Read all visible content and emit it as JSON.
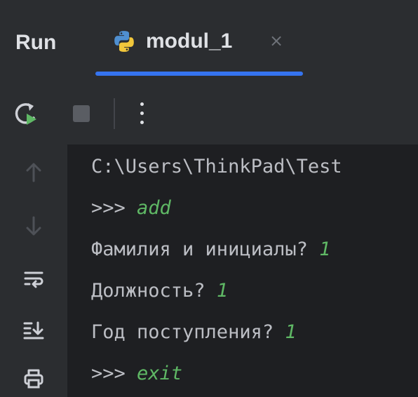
{
  "header": {
    "tool_window_title": "Run",
    "tab": {
      "title": "modul_1",
      "close_glyph": "×",
      "icon": "python-icon"
    }
  },
  "toolbar": {
    "icons": [
      "rerun-icon",
      "stop-icon",
      "more-options-icon"
    ]
  },
  "gutter": {
    "icons": [
      "scroll-up-icon",
      "scroll-down-icon",
      "soft-wrap-icon",
      "scroll-to-end-icon",
      "print-icon"
    ]
  },
  "console": {
    "lines": [
      {
        "text": "C:\\Users\\ThinkPad\\Test",
        "input": ""
      },
      {
        "text": ">>> ",
        "input": "add"
      },
      {
        "text": "Фамилия и инициалы? ",
        "input": "1"
      },
      {
        "text": "Должность? ",
        "input": "1"
      },
      {
        "text": "Год поступления? ",
        "input": "1"
      },
      {
        "text": ">>> ",
        "input": "exit"
      }
    ]
  },
  "colors": {
    "background": "#1e1f22",
    "panel": "#2b2d30",
    "text": "#bcbec4",
    "user_input": "#5fb865",
    "tab_underline": "#3574f0"
  }
}
